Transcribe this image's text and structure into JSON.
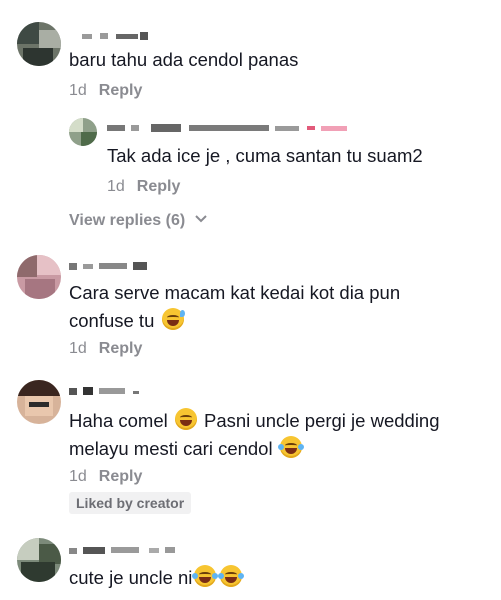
{
  "comments": [
    {
      "text_lines": [
        "baru tahu ada cendol panas"
      ],
      "age": "1d",
      "reply_label": "Reply",
      "replies": [
        {
          "text": "Tak ada ice je , cuma santan tu suam2",
          "age": "1d",
          "reply_label": "Reply"
        }
      ],
      "view_replies": "View replies (6)"
    },
    {
      "text_lines": [
        "Cara serve macam kat kedai kot dia pun",
        "confuse tu"
      ],
      "emoji_after_line2": "grinning-sweat-emoji",
      "age": "1d",
      "reply_label": "Reply"
    },
    {
      "text_line1_a": "Haha comel",
      "text_line1_b": "Pasni uncle pergi je wedding",
      "text_line2": "melayu mesti cari cendol",
      "emojis": [
        "grinning-emoji",
        "tears-of-joy-emoji"
      ],
      "age": "1d",
      "reply_label": "Reply",
      "badge": "Liked by creator"
    },
    {
      "text_lines": [
        "cute je uncle ni"
      ],
      "emojis": [
        "tears-of-joy-emoji",
        "tears-of-joy-emoji"
      ]
    }
  ],
  "colors": {
    "text": "#161823",
    "meta": "#8a8b91",
    "badge_bg": "#f1f1f2"
  }
}
